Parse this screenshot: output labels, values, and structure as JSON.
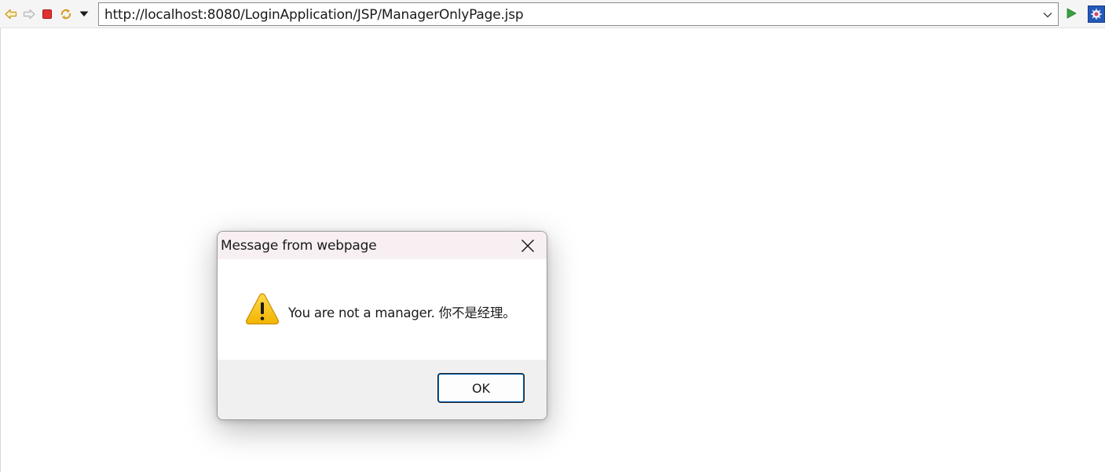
{
  "browser": {
    "url": "http://localhost:8080/LoginApplication/JSP/ManagerOnlyPage.jsp",
    "icons": {
      "back": "back-arrow-icon",
      "forward": "forward-arrow-icon",
      "stop": "stop-icon",
      "refresh": "refresh-icon",
      "menu": "dropdown-triangle-icon",
      "go": "go-play-icon",
      "extension": "eclipse-web-browser-icon"
    }
  },
  "dialog": {
    "title": "Message from webpage",
    "message": "You are not a manager. 你不是经理。",
    "ok_label": "OK",
    "icon": "warning-icon",
    "close_icon": "close-icon"
  }
}
